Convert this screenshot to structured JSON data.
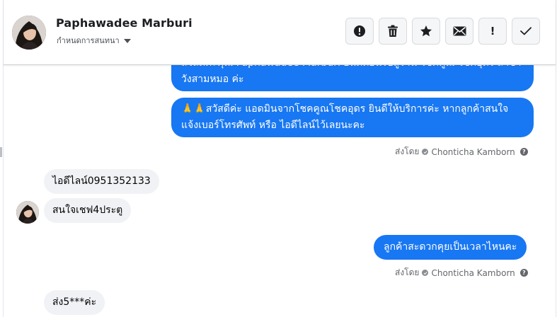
{
  "header": {
    "name": "Paphawadee Marburi",
    "subtitle": "กำหนดการสนทนา",
    "actions": [
      {
        "icon": "alert-circle-icon"
      },
      {
        "icon": "trash-icon"
      },
      {
        "icon": "star-icon"
      },
      {
        "icon": "mail-icon"
      },
      {
        "icon": "exclamation-icon",
        "label": "!"
      },
      {
        "icon": "check-icon"
      }
    ]
  },
  "messages": {
    "out1": {
      "text": "สวัสดีค่ะคุณ Paphawadee Marburi ยินดีต้อนรับสู่ร้าน โชคคูณ โชคอุดร สาขา วังสามหมอ ค่ะ"
    },
    "out2": {
      "emoji": "🙏🙏",
      "text": "สวัสดีค่ะ แอดมินจากโชคคูณโชคอุดร ยินดีให้บริการค่ะ หากลูกค้าสนใจแจ้งเบอร์โทรศัพท์ หรือ ไอดีไลน์ไว้เลยนะคะ"
    },
    "sent1": {
      "prefix": "ส่งโดย",
      "agent": "Chonticha Kamborn"
    },
    "in1": {
      "text": "ไอดีไลน์0951352133"
    },
    "in2": {
      "text": "สนใจเชฟ4ประตู"
    },
    "out3": {
      "text": "ลูกค้าสะดวกคุยเป็นเวลาไหนคะ"
    },
    "sent2": {
      "prefix": "ส่งโดย",
      "agent": "Chonticha Kamborn"
    },
    "in3": {
      "text": "ส่ง5***ค่ะ"
    }
  },
  "colors": {
    "outgoing": "#1877f2",
    "incoming": "#f0f2f5",
    "meta": "#65676b"
  }
}
